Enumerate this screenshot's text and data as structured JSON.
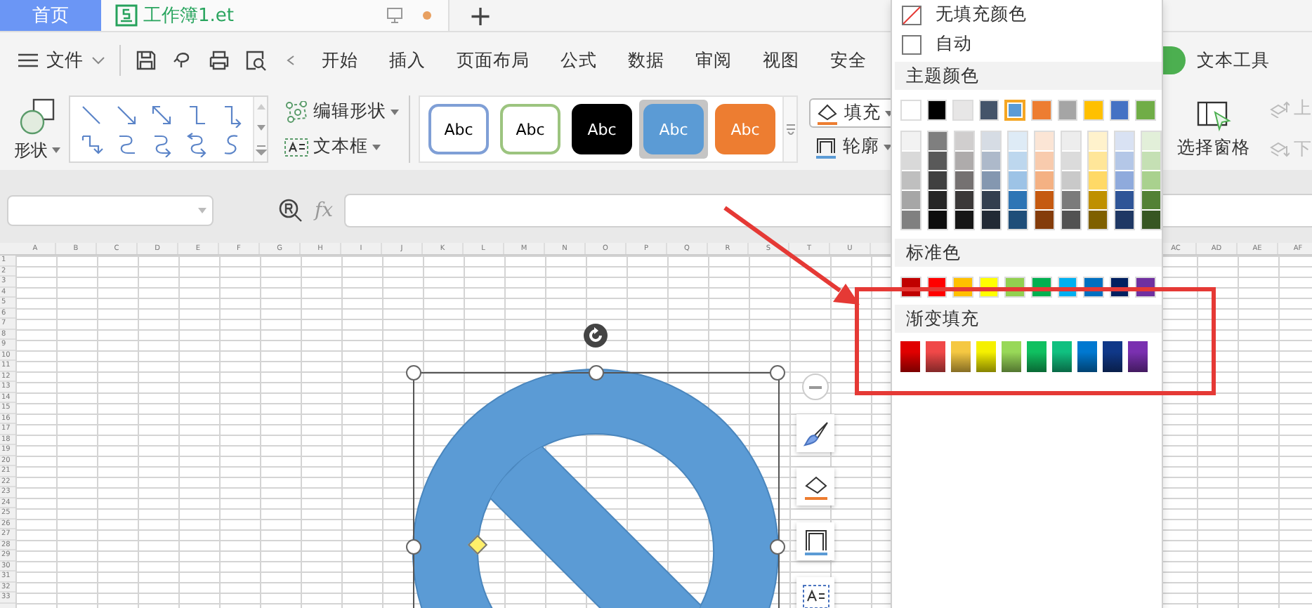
{
  "tabs": [
    {
      "label": "首页",
      "kind": "home",
      "selected": false
    },
    {
      "label": "工作簿1.et",
      "kind": "file",
      "selected": true,
      "modified": true
    }
  ],
  "new_tab": "+",
  "menu": {
    "file": "文件",
    "items": [
      {
        "label": "开始"
      },
      {
        "label": "插入"
      },
      {
        "label": "页面布局"
      },
      {
        "label": "公式"
      },
      {
        "label": "数据"
      },
      {
        "label": "审阅"
      },
      {
        "label": "视图"
      },
      {
        "label": "安全"
      }
    ],
    "context_tab": "文本工具"
  },
  "ribbon": {
    "shape": "形状",
    "edit_shape": "编辑形状",
    "text_box": "文本框",
    "styles": [
      {
        "label": "Abc",
        "kind": "outline",
        "color": "#7f9fd6",
        "selected": false
      },
      {
        "label": "Abc",
        "kind": "outline",
        "color": "#9cc47f",
        "selected": false
      },
      {
        "label": "Abc",
        "kind": "solid",
        "color": "#000000",
        "selected": false
      },
      {
        "label": "Abc",
        "kind": "solid",
        "color": "#5b9bd5",
        "selected": true
      },
      {
        "label": "Abc",
        "kind": "solid",
        "color": "#ed7d31",
        "selected": false
      }
    ],
    "fill": "填充",
    "outline": "轮廓",
    "selection_pane": "选择窗格",
    "bring_forward": "上",
    "send_backward": "下"
  },
  "formula_bar": {
    "fx": "fx"
  },
  "sheet": {
    "columns_left": [
      "A",
      "B",
      "C",
      "D",
      "E",
      "F",
      "G",
      "H",
      "I",
      "J",
      "K",
      "L",
      "M",
      "N",
      "O",
      "P",
      "Q",
      "R",
      "S",
      "T",
      "U"
    ],
    "columns_right": [
      "AC",
      "AD",
      "AE",
      "AF"
    ],
    "rows": [
      "1",
      "2",
      "3",
      "4",
      "5",
      "6",
      "7",
      "8",
      "9",
      "10",
      "11",
      "12",
      "13",
      "14",
      "15",
      "16",
      "17",
      "18",
      "19",
      "20",
      "21",
      "22",
      "23",
      "24",
      "25",
      "26",
      "27",
      "28",
      "29",
      "30",
      "31",
      "32",
      "33"
    ]
  },
  "color_menu": {
    "no_fill": "无填充颜色",
    "auto": "自动",
    "theme_title": "主题颜色",
    "theme_colors": [
      {
        "color": "#ffffff",
        "selected": false
      },
      {
        "color": "#000000",
        "selected": false
      },
      {
        "color": "#e7e6e6",
        "selected": false
      },
      {
        "color": "#44546a",
        "selected": false
      },
      {
        "color": "#5b9bd5",
        "selected": true
      },
      {
        "color": "#ed7d31",
        "selected": false
      },
      {
        "color": "#a5a5a5",
        "selected": false
      },
      {
        "color": "#ffc000",
        "selected": false
      },
      {
        "color": "#4472c4",
        "selected": false
      },
      {
        "color": "#70ad47",
        "selected": false
      }
    ],
    "shade_columns": [
      {
        "swatches": [
          {
            "color": "#f2f2f2"
          },
          {
            "color": "#d9d9d9"
          },
          {
            "color": "#bfbfbf"
          },
          {
            "color": "#a6a6a6"
          },
          {
            "color": "#808080"
          }
        ]
      },
      {
        "swatches": [
          {
            "color": "#7f7f7f"
          },
          {
            "color": "#595959"
          },
          {
            "color": "#404040"
          },
          {
            "color": "#262626"
          },
          {
            "color": "#0d0d0d"
          }
        ]
      },
      {
        "swatches": [
          {
            "color": "#d0cece"
          },
          {
            "color": "#aeabab"
          },
          {
            "color": "#757171"
          },
          {
            "color": "#3b3838"
          },
          {
            "color": "#161616"
          }
        ]
      },
      {
        "swatches": [
          {
            "color": "#d6dce4"
          },
          {
            "color": "#adb9ca"
          },
          {
            "color": "#8497b0"
          },
          {
            "color": "#333f4f"
          },
          {
            "color": "#222a35"
          }
        ]
      },
      {
        "swatches": [
          {
            "color": "#deebf6"
          },
          {
            "color": "#bdd7ee"
          },
          {
            "color": "#9dc3e6"
          },
          {
            "color": "#2e75b5"
          },
          {
            "color": "#1f4e79"
          }
        ]
      },
      {
        "swatches": [
          {
            "color": "#fbe5d5"
          },
          {
            "color": "#f8cbad"
          },
          {
            "color": "#f4b183"
          },
          {
            "color": "#c55a11"
          },
          {
            "color": "#843c0b"
          }
        ]
      },
      {
        "swatches": [
          {
            "color": "#ededed"
          },
          {
            "color": "#dbdbdb"
          },
          {
            "color": "#c9c9c9"
          },
          {
            "color": "#7b7b7b"
          },
          {
            "color": "#525252"
          }
        ]
      },
      {
        "swatches": [
          {
            "color": "#fff2cc"
          },
          {
            "color": "#ffe699"
          },
          {
            "color": "#ffd966"
          },
          {
            "color": "#bf9000"
          },
          {
            "color": "#7f6000"
          }
        ]
      },
      {
        "swatches": [
          {
            "color": "#d9e2f3"
          },
          {
            "color": "#b4c7e7"
          },
          {
            "color": "#8faadc"
          },
          {
            "color": "#2f5597"
          },
          {
            "color": "#1f3864"
          }
        ]
      },
      {
        "swatches": [
          {
            "color": "#e2efd9"
          },
          {
            "color": "#c5e0b4"
          },
          {
            "color": "#a9d18e"
          },
          {
            "color": "#538135"
          },
          {
            "color": "#375623"
          }
        ]
      }
    ],
    "standard_title": "标准色",
    "standard_colors": [
      {
        "color": "#c00000"
      },
      {
        "color": "#ff0000"
      },
      {
        "color": "#ffc000"
      },
      {
        "color": "#ffff00"
      },
      {
        "color": "#92d050"
      },
      {
        "color": "#00b050"
      },
      {
        "color": "#00b0f0"
      },
      {
        "color": "#0070c0"
      },
      {
        "color": "#002060"
      },
      {
        "color": "#7030a0"
      }
    ],
    "gradient_title": "渐变填充",
    "gradient_colors": [
      {
        "color": "#e00000"
      },
      {
        "color": "#f04848"
      },
      {
        "color": "#f5c842"
      },
      {
        "color": "#f5f000"
      },
      {
        "color": "#98d858"
      },
      {
        "color": "#10c060"
      },
      {
        "color": "#10c080"
      },
      {
        "color": "#0078d0"
      },
      {
        "color": "#103888"
      },
      {
        "color": "#7a30b0"
      }
    ]
  }
}
